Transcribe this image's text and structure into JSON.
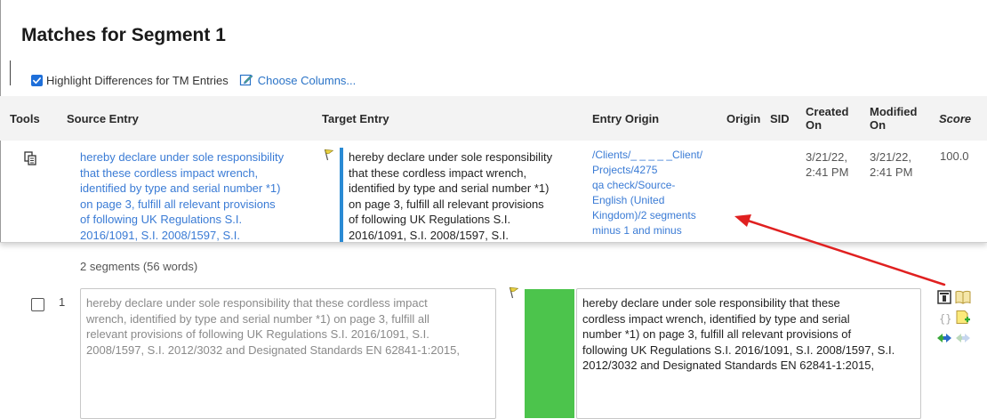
{
  "popup": {
    "title": "Matches for Segment 1",
    "highlight_label": "Highlight Differences for TM Entries",
    "highlight_checked": true,
    "choose_columns_label": "Choose Columns...",
    "columns": {
      "tools": "Tools",
      "source_entry": "Source Entry",
      "target_entry": "Target Entry",
      "entry_origin": "Entry Origin",
      "origin": "Origin",
      "sid": "SID",
      "created_1": "Created",
      "created_2": "On",
      "modified_1": "Modified",
      "modified_2": "On",
      "score": "Score"
    },
    "match": {
      "source_lines": [
        "hereby declare under sole responsibility",
        "that these cordless impact wrench,",
        "identified by type and serial number *1)",
        "on page 3, fulfill all relevant provisions",
        "of following UK Regulations S.I.",
        "2016/1091, S.I. 2008/1597, S.I."
      ],
      "target_lines": [
        "hereby declare under sole responsibility",
        "that these cordless impact wrench,",
        "identified by type and serial number *1)",
        "on page 3, fulfill all relevant provisions",
        "of following UK Regulations S.I.",
        "2016/1091, S.I. 2008/1597, S.I."
      ],
      "origin_lines": [
        "/Clients/_ _ _ _ _Client/",
        "Projects/4275",
        "qa check/Source-",
        "English (United",
        "Kingdom)/2 segments",
        "minus 1 and minus"
      ],
      "created_line1": "3/21/22,",
      "created_line2": "2:41 PM",
      "modified_line1": "3/21/22,",
      "modified_line2": "2:41 PM",
      "score": "100.0"
    }
  },
  "editor": {
    "segments_count": "2 segments (56 words)",
    "row_number": "1",
    "source_lines": [
      "hereby declare under sole responsibility that these cordless impact",
      "wrench, identified by type and serial number *1) on page 3, fulfill all",
      "relevant provisions of following UK Regulations S.I. 2016/1091, S.I.",
      "2008/1597, S.I. 2012/3032 and Designated Standards EN 62841-1:2015,"
    ],
    "target_lines": [
      "hereby declare under sole responsibility that these",
      "cordless impact wrench, identified by type and serial",
      "number *1) on page 3, fulfill all relevant provisions of",
      "following UK Regulations S.I. 2016/1091, S.I. 2008/1597, S.I.",
      "2012/3032 and Designated Standards EN 62841-1:2015,"
    ]
  },
  "colors": {
    "accent_blue": "#3a7bd5",
    "target_bar": "#2a8ad4",
    "match_green": "#4cc44c",
    "arrow_red": "#e02020"
  },
  "icons": [
    "copy-icon",
    "flag-icon",
    "edit-icon",
    "checkbox-icon",
    "columns-icon",
    "book-icon",
    "braces-icon",
    "add-note-icon",
    "insert-left-icon",
    "insert-right-icon"
  ]
}
